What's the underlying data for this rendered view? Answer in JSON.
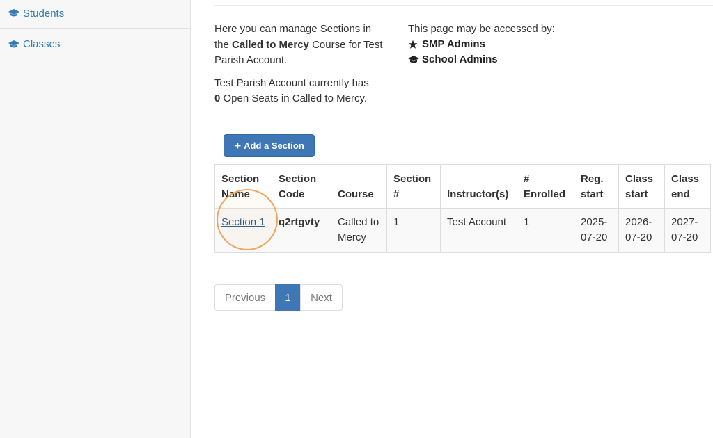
{
  "sidebar": {
    "items": [
      {
        "label": "Students",
        "icon": "graduation-cap-icon"
      },
      {
        "label": "Classes",
        "icon": "graduation-cap-icon"
      }
    ]
  },
  "intro": {
    "line1_pre": "Here you can manage Sections in the ",
    "course_name": "Called to Mercy",
    "line1_post": " Course for Test Parish Account.",
    "seats_pre": "Test Parish Account currently has ",
    "seats_count": "0",
    "seats_post": " Open Seats in Called to Mercy."
  },
  "access": {
    "heading": "This page may be accessed by:",
    "roles": [
      {
        "label": "SMP Admins",
        "icon": "star-icon"
      },
      {
        "label": "School Admins",
        "icon": "graduation-cap-icon"
      }
    ]
  },
  "toolbar": {
    "add_section_label": "Add a Section"
  },
  "table": {
    "headers": [
      "Section Name",
      "Section Code",
      "Course",
      "Section #",
      "Instructor(s)",
      "# Enrolled",
      "Reg. start",
      "Class start",
      "Class end"
    ],
    "rows": [
      {
        "section_name": "Section 1",
        "section_code": "q2rtgvty",
        "course": "Called to Mercy",
        "section_number": "1",
        "instructors": "Test Account",
        "enrolled": "1",
        "reg_start": "2025-07-20",
        "class_start": "2026-07-20",
        "class_end": "2027-07-20"
      }
    ]
  },
  "pagination": {
    "previous": "Previous",
    "current": "1",
    "next": "Next"
  },
  "colors": {
    "primary": "#3f77b6",
    "link": "#337ab7",
    "highlight": "#f0a35a"
  }
}
